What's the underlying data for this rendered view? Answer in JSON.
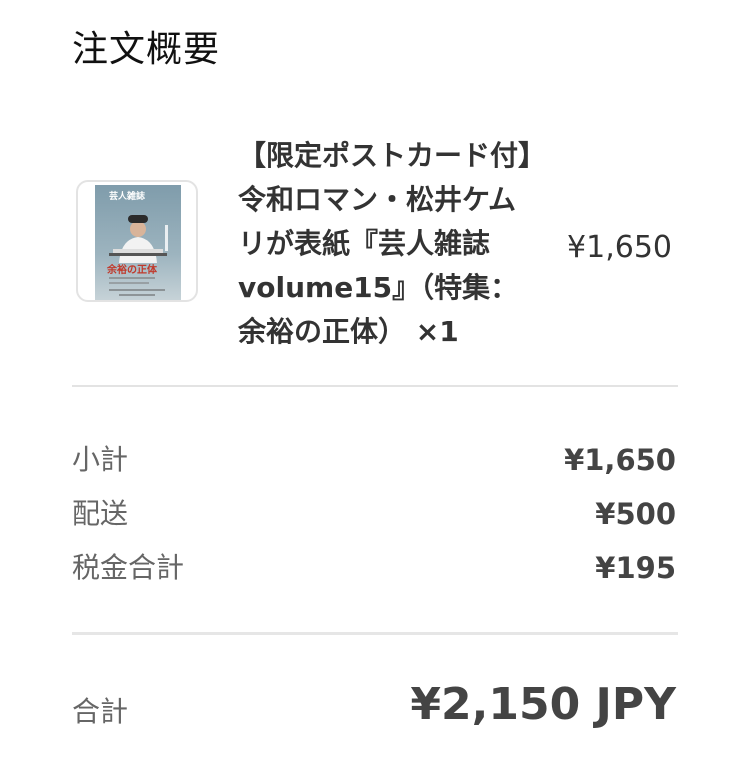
{
  "header": {
    "title": "注文概要"
  },
  "line_item": {
    "name": "【限定ポストカード付】令和ロマン・松井ケムリが表紙『芸人雑誌 volume15』（特集：余裕の正体） ×1",
    "price": "¥1,650",
    "thumbnail": {
      "cover_title": "芸人雑誌",
      "cover_headline": "余裕の正体",
      "background_color": "#8fa9b6"
    }
  },
  "summary": {
    "rows": [
      {
        "label": "小計",
        "value": "¥1,650"
      },
      {
        "label": "配送",
        "value": "¥500"
      },
      {
        "label": "税金合計",
        "value": "¥195"
      }
    ],
    "total_label": "合計",
    "total_value": "¥2,150 JPY"
  },
  "colors": {
    "text_primary": "#333333",
    "text_secondary": "#666666",
    "divider": "#e3e3e3",
    "accent_red": "#c0392b"
  }
}
